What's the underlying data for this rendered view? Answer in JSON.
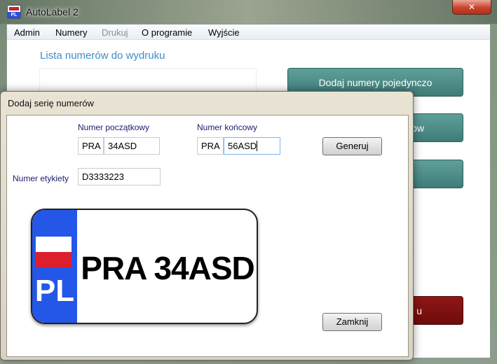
{
  "window": {
    "title": "AutoLabel 2",
    "close_glyph": "✕"
  },
  "menu": [
    "Admin",
    "Numery",
    "Drukuj",
    "O programie",
    "Wyjście"
  ],
  "main": {
    "list_heading": "Lista numerów do wydruku",
    "buttons": [
      {
        "label": "Dodaj numery pojedynczo"
      },
      {
        "label": "ow"
      },
      {
        "label": ""
      },
      {
        "label": "u"
      }
    ]
  },
  "dialog": {
    "title": "Dodaj serię numerów",
    "start_label": "Numer początkowy",
    "start_prefix": "PRA",
    "start_value": "34ASD",
    "end_label": "Numer końcowy",
    "end_prefix": "PRA",
    "end_value": "56ASD",
    "label_number_label": "Numer etykiety",
    "label_number_value": "D3333223",
    "generate_label": "Generuj",
    "close_label": "Zamknij",
    "plate": {
      "country": "PL",
      "number": "PRA 34ASD",
      "band_color": "#2457e8",
      "flag_red": "#dc1f2c"
    }
  },
  "colors": {
    "accent_teal": "#4a8a86",
    "danger_red": "#7d1010",
    "heading_blue": "#3b8fc8"
  }
}
